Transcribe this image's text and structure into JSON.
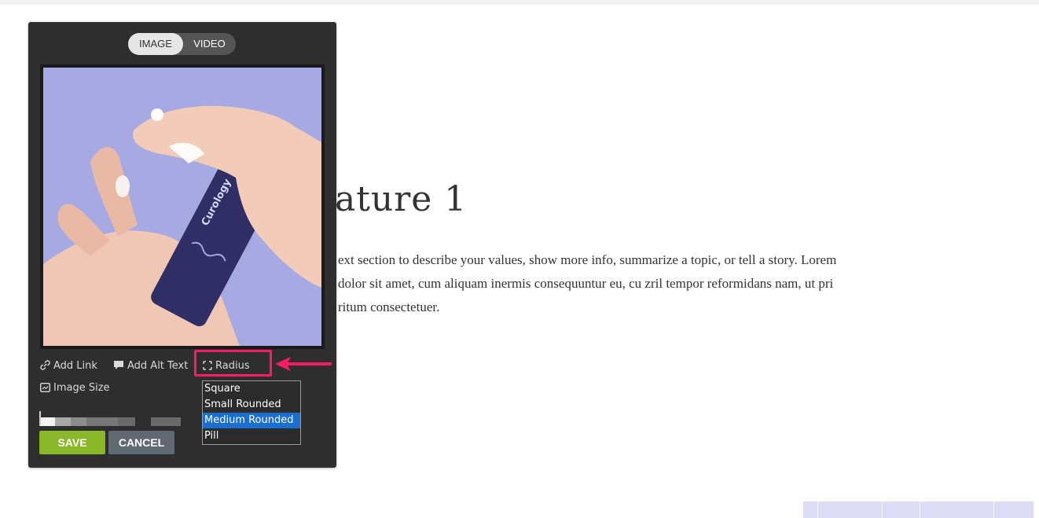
{
  "toggle": {
    "image_label": "IMAGE",
    "video_label": "VIDEO"
  },
  "image": {
    "brand_text": "Curology"
  },
  "tools": {
    "add_link": "Add Link",
    "add_alt_text": "Add Alt Text",
    "radius": "Radius",
    "image_size": "Image Size"
  },
  "radius_options": [
    "Square",
    "Small Rounded",
    "Medium Rounded",
    "Pill"
  ],
  "radius_selected": "Medium Rounded",
  "buttons": {
    "save": "SAVE",
    "cancel": "CANCEL"
  },
  "page": {
    "feature_title": "ature 1",
    "feature_lines": [
      "ext section to describe your values, show more info, summarize a topic, or tell a story. Lorem",
      "dolor sit amet, cum aliquam inermis consequuntur eu, cu zril tempor reformidans nam, ut pri",
      "ritum consectetuer."
    ]
  },
  "colors": {
    "accent_highlight": "#ff1a66",
    "save_green": "#8bb82b",
    "selected_blue": "#1a6fd0"
  }
}
